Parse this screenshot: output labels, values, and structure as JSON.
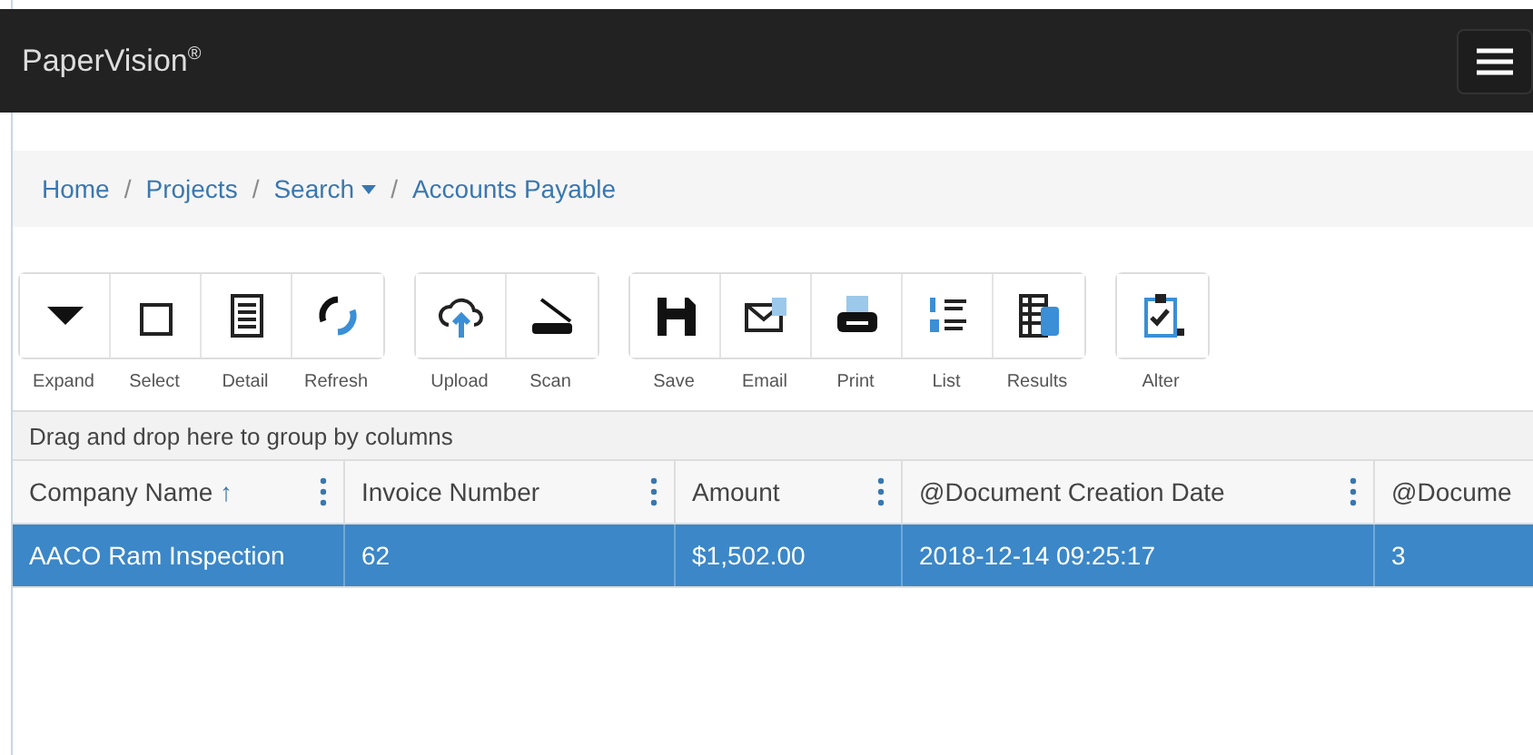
{
  "navbar": {
    "brand": "PaperVision",
    "brand_mark": "®"
  },
  "breadcrumb": [
    {
      "label": "Home",
      "dropdown": false
    },
    {
      "separator": "/",
      "label": "Projects",
      "dropdown": false
    },
    {
      "separator": "/",
      "label": "Search",
      "dropdown": true
    },
    {
      "separator": "/",
      "label": "Accounts Payable",
      "dropdown": false
    }
  ],
  "toolbar": [
    {
      "items": [
        "Expand",
        "Select",
        "Detail",
        "Refresh"
      ]
    },
    {
      "items": [
        "Upload",
        "Scan"
      ]
    },
    {
      "items": [
        "Save",
        "Email",
        "Print",
        "List",
        "Results"
      ]
    },
    {
      "items": [
        "Alter"
      ]
    }
  ],
  "group_panel": "Drag and drop here to group by columns",
  "table": {
    "columns": [
      {
        "label": "Company Name",
        "sort": "↑"
      },
      {
        "label": "Invoice Number"
      },
      {
        "label": "Amount"
      },
      {
        "label": "@Document Creation Date"
      },
      {
        "label": "@Docume"
      }
    ],
    "rows": [
      {
        "selected": true,
        "cells": [
          "AACO Ram Inspection",
          "62",
          "$1,502.00",
          "2018-12-14 09:25:17",
          "3"
        ]
      }
    ]
  }
}
